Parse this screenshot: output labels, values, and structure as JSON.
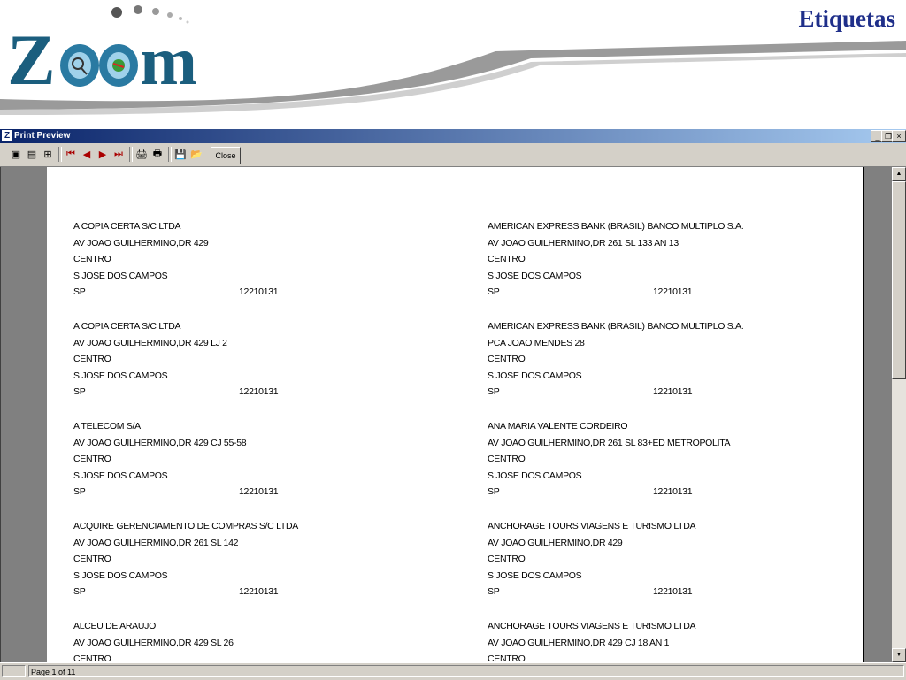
{
  "header": {
    "page_title": "Etiquetas",
    "logo_text": "Zoom"
  },
  "window": {
    "title": "Print Preview",
    "title_icon": "Z",
    "buttons": {
      "minimize": "_",
      "restore": "❐",
      "close": "×"
    }
  },
  "toolbar": {
    "tools": [
      {
        "name": "one-page-view-icon",
        "glyph": "▣"
      },
      {
        "name": "two-page-view-icon",
        "glyph": "▤"
      },
      {
        "name": "zoom-page-icon",
        "glyph": "⊞"
      },
      {
        "name": "first-page-icon",
        "glyph": "⏮"
      },
      {
        "name": "previous-page-icon",
        "glyph": "◀"
      },
      {
        "name": "next-page-icon",
        "glyph": "▶"
      },
      {
        "name": "last-page-icon",
        "glyph": "⏭"
      },
      {
        "name": "print-setup-icon",
        "glyph": "🖨"
      },
      {
        "name": "print-icon",
        "glyph": "🖶"
      },
      {
        "name": "save-icon",
        "glyph": "💾"
      },
      {
        "name": "open-icon",
        "glyph": "📂"
      }
    ],
    "close_label": "Close"
  },
  "labels": [
    {
      "lines": [
        "A COPIA CERTA S/C LTDA",
        "AV JOAO GUILHERMINO,DR 429",
        "CENTRO",
        "S JOSE DOS CAMPOS"
      ],
      "uf": "SP",
      "cep": "12210131"
    },
    {
      "lines": [
        "AMERICAN EXPRESS BANK (BRASIL) BANCO MULTIPLO S.A.",
        "AV JOAO GUILHERMINO,DR 261 SL 133 AN 13",
        "CENTRO",
        "S JOSE DOS CAMPOS"
      ],
      "uf": "SP",
      "cep": "12210131"
    },
    {
      "lines": [
        "A COPIA CERTA S/C LTDA",
        "AV JOAO GUILHERMINO,DR 429 LJ 2",
        "CENTRO",
        "S JOSE DOS CAMPOS"
      ],
      "uf": "SP",
      "cep": "12210131"
    },
    {
      "lines": [
        "AMERICAN EXPRESS BANK (BRASIL) BANCO MULTIPLO S.A.",
        "PCA JOAO MENDES 28",
        "CENTRO",
        "S JOSE DOS CAMPOS"
      ],
      "uf": "SP",
      "cep": "12210131"
    },
    {
      "lines": [
        "A TELECOM S/A",
        "AV JOAO GUILHERMINO,DR 429 CJ 55-58",
        "CENTRO",
        "S JOSE DOS CAMPOS"
      ],
      "uf": "SP",
      "cep": "12210131"
    },
    {
      "lines": [
        "ANA MARIA VALENTE CORDEIRO",
        "AV JOAO GUILHERMINO,DR 261 SL 83+ED METROPOLITA",
        "CENTRO",
        "S JOSE DOS CAMPOS"
      ],
      "uf": "SP",
      "cep": "12210131"
    },
    {
      "lines": [
        "ACQUIRE GERENCIAMENTO DE COMPRAS S/C LTDA",
        "AV JOAO GUILHERMINO,DR 261 SL 142",
        "CENTRO",
        "S JOSE DOS CAMPOS"
      ],
      "uf": "SP",
      "cep": "12210131"
    },
    {
      "lines": [
        "ANCHORAGE TOURS VIAGENS E TURISMO LTDA",
        "AV JOAO GUILHERMINO,DR 429",
        "CENTRO",
        "S JOSE DOS CAMPOS"
      ],
      "uf": "SP",
      "cep": "12210131"
    },
    {
      "lines": [
        "ALCEU DE ARAUJO",
        "AV JOAO GUILHERMINO,DR 429 SL 26",
        "CENTRO"
      ],
      "uf": "",
      "cep": ""
    },
    {
      "lines": [
        "ANCHORAGE TOURS VIAGENS E TURISMO LTDA",
        "AV JOAO GUILHERMINO,DR 429 CJ 18 AN 1",
        "CENTRO"
      ],
      "uf": "",
      "cep": ""
    }
  ],
  "scrollbar": {
    "up": "▲",
    "down": "▼"
  },
  "status": {
    "page_text": "Page 1 of 11"
  }
}
